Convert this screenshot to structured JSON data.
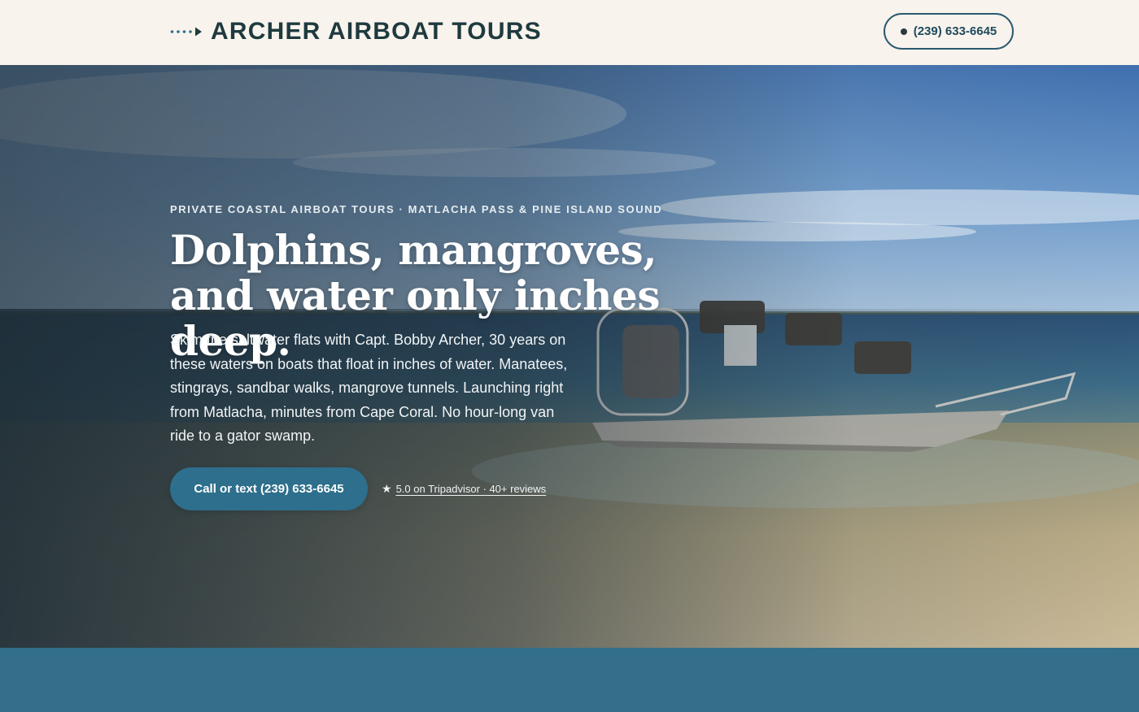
{
  "header": {
    "brand_name": "ARCHER AIRBOAT TOURS",
    "brand_icon": "dotted-arrow-icon",
    "phone_label": "(239) 633-6645",
    "phone_icon": "dot-icon"
  },
  "hero": {
    "eyebrow": "PRIVATE COASTAL AIRBOAT TOURS · MATLACHA PASS & PINE ISLAND SOUND",
    "headline": "Dolphins, mangroves, and water only inches deep.",
    "lede": "Skim the saltwater flats with Capt. Bobby Archer, 30 years on these waters on boats that float in inches of water. Manatees, stingrays, sandbar walks, mangrove tunnels. Launching right from Matlacha, minutes from Cape Coral. No hour-long van ride to a gator swamp.",
    "cta_label": "Call or text (239) 633-6645",
    "review_star": "★",
    "review_label": "5.0 on Tripadvisor · 40+ reviews",
    "background_image": "airboat-on-sandbar-photo"
  },
  "colors": {
    "header_bg": "#f8f3ec",
    "brand_text": "#1e3a3f",
    "accent": "#2d6f8c",
    "band": "#336f8a"
  }
}
